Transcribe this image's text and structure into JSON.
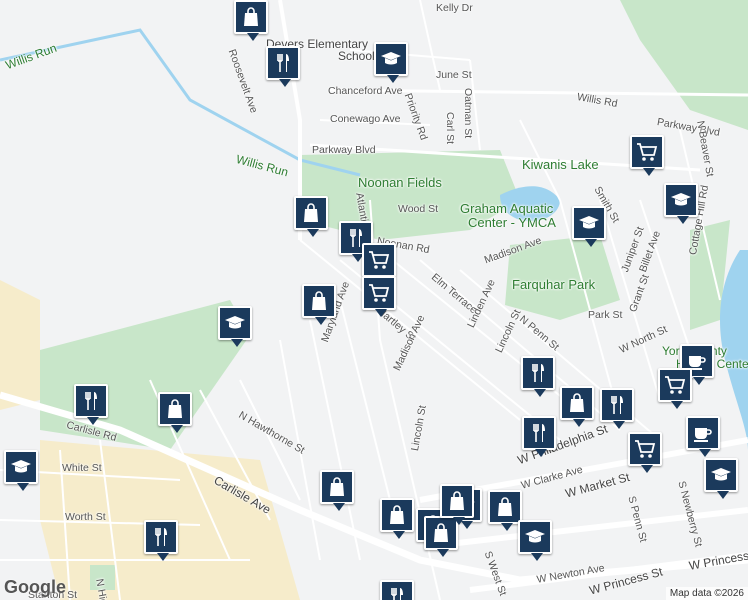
{
  "map": {
    "attribution": "Map data ©2026",
    "logo": "Google",
    "colors": {
      "park": "#c8e6c9",
      "water": "#9fd3ef",
      "road": "#ffffff",
      "land": "#f2f3f4",
      "pin": "#1b3a5c",
      "sand": "#f6eccb"
    },
    "labels": [
      {
        "text": "Kelly Dr",
        "kind": "road"
      },
      {
        "text": "Devers Elementary",
        "kind": "big"
      },
      {
        "text": "School",
        "kind": "big"
      },
      {
        "text": "Willis Run",
        "kind": "poi"
      },
      {
        "text": "Roosevelt Ave",
        "kind": "road"
      },
      {
        "text": "June St",
        "kind": "road"
      },
      {
        "text": "Willis Rd",
        "kind": "road"
      },
      {
        "text": "Chanceford Ave",
        "kind": "road"
      },
      {
        "text": "Conewago Ave",
        "kind": "road"
      },
      {
        "text": "Carl St",
        "kind": "road"
      },
      {
        "text": "Oatman St",
        "kind": "road"
      },
      {
        "text": "Priority Rd",
        "kind": "road"
      },
      {
        "text": "Parkway Blvd",
        "kind": "road"
      },
      {
        "text": "Parkway Blvd",
        "kind": "road"
      },
      {
        "text": "Willis Run",
        "kind": "poi"
      },
      {
        "text": "Kiwanis Lake",
        "kind": "park"
      },
      {
        "text": "Noonan Fields",
        "kind": "park"
      },
      {
        "text": "Wood St",
        "kind": "road"
      },
      {
        "text": "Graham Aquatic",
        "kind": "park"
      },
      {
        "text": "Center - YMCA",
        "kind": "park"
      },
      {
        "text": "Noonan Rd",
        "kind": "road"
      },
      {
        "text": "Atlantic Ave",
        "kind": "road"
      },
      {
        "text": "Madison Ave",
        "kind": "road"
      },
      {
        "text": "Elm Terrace",
        "kind": "road"
      },
      {
        "text": "Farquhar Park",
        "kind": "park"
      },
      {
        "text": "Hartley St",
        "kind": "road"
      },
      {
        "text": "Maryland Ave",
        "kind": "road"
      },
      {
        "text": "Madison Ave",
        "kind": "road"
      },
      {
        "text": "Linden Ave",
        "kind": "road"
      },
      {
        "text": "N Penn St",
        "kind": "road"
      },
      {
        "text": "Lincoln St",
        "kind": "road"
      },
      {
        "text": "Park St",
        "kind": "road"
      },
      {
        "text": "W North St",
        "kind": "road"
      },
      {
        "text": "Grant St",
        "kind": "road"
      },
      {
        "text": "Juniper St",
        "kind": "road"
      },
      {
        "text": "Billet Ave",
        "kind": "road"
      },
      {
        "text": "Cottage Hill Rd",
        "kind": "road"
      },
      {
        "text": "Smith St",
        "kind": "road"
      },
      {
        "text": "N Beaver St",
        "kind": "road"
      },
      {
        "text": "Carlisle Rd",
        "kind": "road"
      },
      {
        "text": "N Hawthorne St",
        "kind": "road"
      },
      {
        "text": "White St",
        "kind": "road"
      },
      {
        "text": "Carlisle Ave",
        "kind": "big"
      },
      {
        "text": "Worth St",
        "kind": "road"
      },
      {
        "text": "Lincoln St",
        "kind": "road"
      },
      {
        "text": "W Philadelphia St",
        "kind": "big"
      },
      {
        "text": "W Clarke Ave",
        "kind": "road"
      },
      {
        "text": "W Market St",
        "kind": "big"
      },
      {
        "text": "S Penn St",
        "kind": "road"
      },
      {
        "text": "S Newberry St",
        "kind": "road"
      },
      {
        "text": "W Princess",
        "kind": "big"
      },
      {
        "text": "W Newton Ave",
        "kind": "road"
      },
      {
        "text": "W Princess St",
        "kind": "big"
      },
      {
        "text": "S West St",
        "kind": "road"
      },
      {
        "text": "N High St",
        "kind": "road"
      },
      {
        "text": "Stanton St",
        "kind": "road"
      },
      {
        "text": "York County",
        "kind": "poi"
      },
      {
        "text": "History Center",
        "kind": "poi"
      }
    ],
    "pins": [
      {
        "icon": "shopping-bag-icon"
      },
      {
        "icon": "restaurant-icon"
      },
      {
        "icon": "school-icon"
      },
      {
        "icon": "shopping-cart-icon"
      },
      {
        "icon": "school-icon"
      },
      {
        "icon": "school-icon"
      },
      {
        "icon": "shopping-bag-icon"
      },
      {
        "icon": "restaurant-icon"
      },
      {
        "icon": "shopping-cart-icon"
      },
      {
        "icon": "shopping-cart-icon"
      },
      {
        "icon": "shopping-bag-icon"
      },
      {
        "icon": "school-icon"
      },
      {
        "icon": "restaurant-icon"
      },
      {
        "icon": "coffee-icon"
      },
      {
        "icon": "restaurant-icon"
      },
      {
        "icon": "shopping-bag-icon"
      },
      {
        "icon": "shopping-cart-icon"
      },
      {
        "icon": "shopping-bag-icon"
      },
      {
        "icon": "restaurant-icon"
      },
      {
        "icon": "restaurant-icon"
      },
      {
        "icon": "shopping-cart-icon"
      },
      {
        "icon": "coffee-icon"
      },
      {
        "icon": "school-icon"
      },
      {
        "icon": "school-icon"
      },
      {
        "icon": "shopping-bag-icon"
      },
      {
        "icon": "shopping-bag-icon"
      },
      {
        "icon": "shopping-bag-icon"
      },
      {
        "icon": "school-icon"
      },
      {
        "icon": "shopping-bag-icon"
      },
      {
        "icon": "shopping-bag-icon"
      },
      {
        "icon": "shopping-bag-icon"
      },
      {
        "icon": "school-icon"
      },
      {
        "icon": "restaurant-icon"
      },
      {
        "icon": "restaurant-icon"
      }
    ]
  }
}
